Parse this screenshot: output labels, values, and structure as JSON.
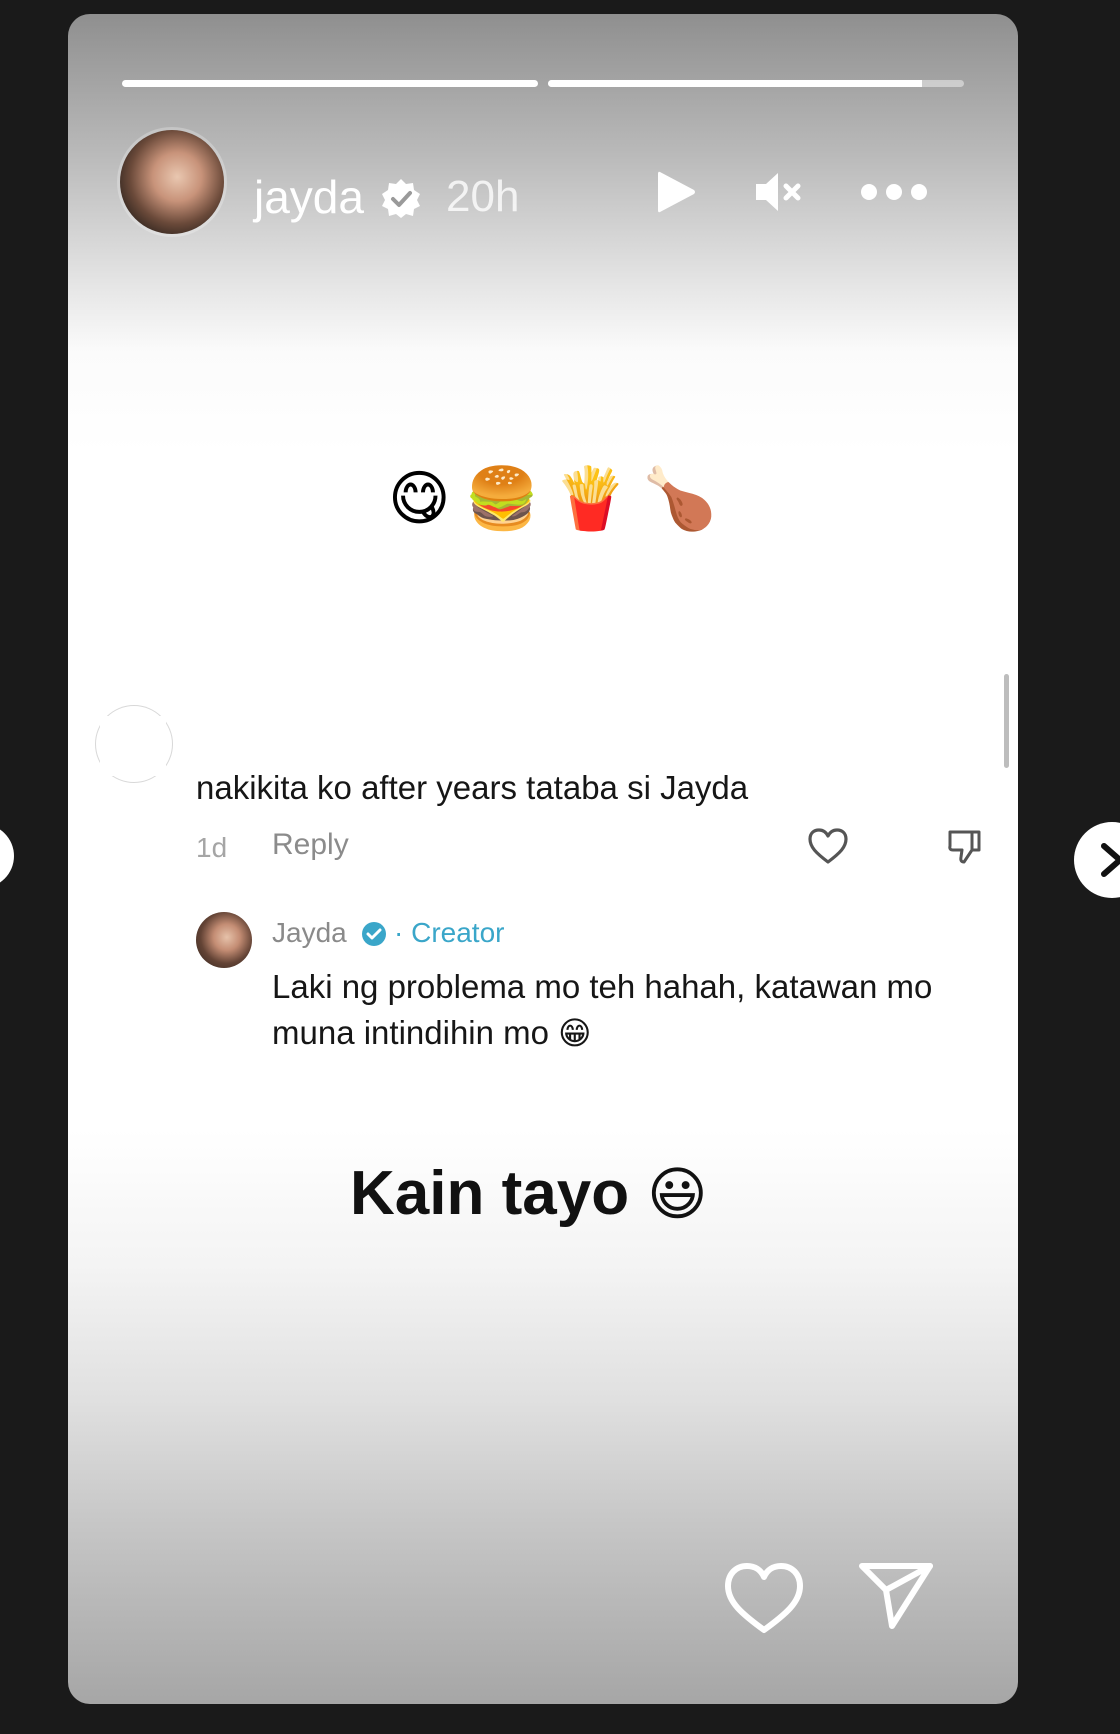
{
  "story": {
    "username": "jayda",
    "time_ago": "20h",
    "progress": [
      1.0,
      0.9
    ],
    "food_emojis": [
      "😋",
      "🍔",
      "🍟",
      "🍗"
    ],
    "caption": "Kain tayo",
    "caption_emoji": "😃"
  },
  "comment": {
    "text": "nakikita ko after years tataba si Jayda",
    "age": "1d",
    "reply_label": "Reply"
  },
  "reply": {
    "name": "Jayda",
    "role": "· Creator",
    "text": "Laki ng problema mo teh hahah, katawan mo muna intindihin mo",
    "emoji": "😁"
  },
  "colors": {
    "verified_blue": "#3aa6c9",
    "text_dark": "#161616",
    "muted": "#8a8a8a"
  },
  "icons": {
    "header": [
      "verified-icon",
      "play-icon",
      "mute-icon",
      "more-icon"
    ],
    "comment": [
      "heart-outline-icon",
      "thumbs-down-icon"
    ],
    "footer": [
      "heart-outline-icon",
      "send-icon"
    ],
    "nav": [
      "chevron-left-icon",
      "chevron-right-icon"
    ]
  }
}
